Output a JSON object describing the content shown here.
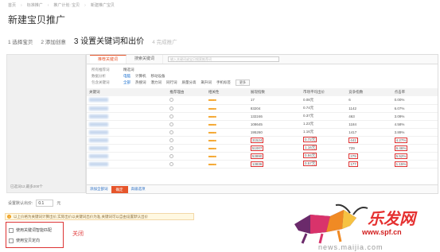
{
  "breadcrumb": [
    "首页",
    "标准推广",
    "推广计划: 宝贝",
    "新建推广宝贝"
  ],
  "page_title": "新建宝贝推广",
  "steps": [
    {
      "label": "1 选择宝贝",
      "state": "done"
    },
    {
      "label": "2 添加创意",
      "state": "done"
    },
    {
      "label": "3 设置关键词和出价",
      "state": "active"
    },
    {
      "label": "4 完成推广",
      "state": "disabled"
    }
  ],
  "left_panel": {
    "count_text": "已选词12,最多200个"
  },
  "tabs": [
    "推荐关键词",
    "搜索关键词"
  ],
  "search": {
    "placeholder": "输入关键词或宝贝搜索推荐词"
  },
  "filters": {
    "row1": {
      "label": "所有推荐词",
      "options": [
        "精选词"
      ]
    },
    "row2": {
      "label": "数据分析",
      "options": [
        "电脑",
        "计算机",
        "移动设备"
      ]
    },
    "row3": {
      "label": "包含关键词",
      "options": [
        "全部",
        "热搜词",
        "潜力词",
        "同行词",
        "质量分高",
        "飙升词",
        "手机标签"
      ],
      "more": "更多"
    }
  },
  "table": {
    "headers": [
      "关键词",
      "推荐理由",
      "相关性",
      "展现指数",
      "市场平均出价",
      "竞争指数",
      "点击率"
    ],
    "rows": [
      {
        "impr": "17",
        "avg_bid": "0.08元",
        "comp": "6",
        "ctr": "0.00%"
      },
      {
        "impr": "83204",
        "avg_bid": "0.74元",
        "comp": "1142",
        "ctr": "6.07%"
      },
      {
        "impr": "132246",
        "avg_bid": "0.37元",
        "comp": "463",
        "ctr": "3.09%"
      },
      {
        "impr": "108645",
        "avg_bid": "1.23元",
        "comp": "1184",
        "ctr": "4.58%"
      },
      {
        "impr": "195260",
        "avg_bid": "1.16元",
        "comp": "1417",
        "ctr": "3.89%"
      },
      {
        "impr": "31524",
        "avg_bid": "0.72元",
        "comp": "441",
        "ctr": "4.27%"
      },
      {
        "impr": "51007",
        "avg_bid": "1.16元",
        "comp": "729",
        "ctr": "6.46%"
      },
      {
        "impr": "53890",
        "avg_bid": "0.94元",
        "comp": "279",
        "ctr": "5.52%"
      },
      {
        "impr": "13836",
        "avg_bid": "0.57元",
        "comp": "177",
        "ctr": "1.15%"
      }
    ]
  },
  "bottom_bar": {
    "add_all": "添加全部词",
    "confirm": "确定",
    "advanced": "高级选项"
  },
  "bid": {
    "label": "设置默认出价:",
    "value": "0.1",
    "unit": "元"
  },
  "warning": "以上价格为关键词计算出价,实际出价以关键词出价为准,关键词可以自由设置默认出价",
  "checks": [
    "使用关键词智能匹配",
    "使用宝贝定向"
  ],
  "close_label": "关闭",
  "watermark": {
    "brand": "乐发网",
    "url": "www.spf.cn",
    "bottom": "news.maijia.com"
  },
  "colors": {
    "accent": "#e6552b",
    "highlight": "#d33333",
    "link": "#2a6ec4"
  }
}
